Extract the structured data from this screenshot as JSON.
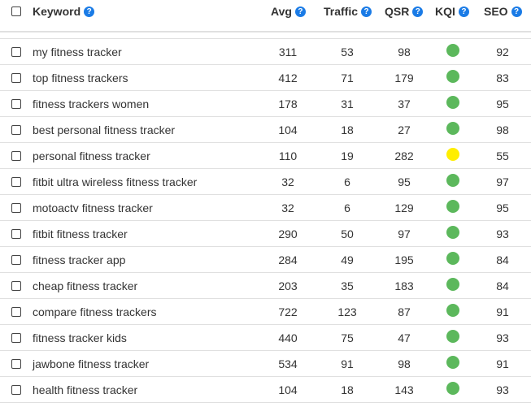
{
  "header": {
    "keyword": "Keyword",
    "avg": "Avg",
    "traffic": "Traffic",
    "qsr": "QSR",
    "kqi": "KQI",
    "seo": "SEO",
    "help_icon": "?"
  },
  "kqi_colors": {
    "green": "#5cb85c",
    "yellow": "#ffee00"
  },
  "rows": [
    {
      "keyword": "my fitness tracker",
      "avg": "311",
      "traffic": "53",
      "qsr": "98",
      "kqi": "green",
      "seo": "92"
    },
    {
      "keyword": "top fitness trackers",
      "avg": "412",
      "traffic": "71",
      "qsr": "179",
      "kqi": "green",
      "seo": "83"
    },
    {
      "keyword": "fitness trackers women",
      "avg": "178",
      "traffic": "31",
      "qsr": "37",
      "kqi": "green",
      "seo": "95"
    },
    {
      "keyword": "best personal fitness tracker",
      "avg": "104",
      "traffic": "18",
      "qsr": "27",
      "kqi": "green",
      "seo": "98"
    },
    {
      "keyword": "personal fitness tracker",
      "avg": "110",
      "traffic": "19",
      "qsr": "282",
      "kqi": "yellow",
      "seo": "55"
    },
    {
      "keyword": "fitbit ultra wireless fitness tracker",
      "avg": "32",
      "traffic": "6",
      "qsr": "95",
      "kqi": "green",
      "seo": "97"
    },
    {
      "keyword": "motoactv fitness tracker",
      "avg": "32",
      "traffic": "6",
      "qsr": "129",
      "kqi": "green",
      "seo": "95"
    },
    {
      "keyword": "fitbit fitness tracker",
      "avg": "290",
      "traffic": "50",
      "qsr": "97",
      "kqi": "green",
      "seo": "93"
    },
    {
      "keyword": "fitness tracker app",
      "avg": "284",
      "traffic": "49",
      "qsr": "195",
      "kqi": "green",
      "seo": "84"
    },
    {
      "keyword": "cheap fitness tracker",
      "avg": "203",
      "traffic": "35",
      "qsr": "183",
      "kqi": "green",
      "seo": "84"
    },
    {
      "keyword": "compare fitness trackers",
      "avg": "722",
      "traffic": "123",
      "qsr": "87",
      "kqi": "green",
      "seo": "91"
    },
    {
      "keyword": "fitness tracker kids",
      "avg": "440",
      "traffic": "75",
      "qsr": "47",
      "kqi": "green",
      "seo": "93"
    },
    {
      "keyword": "jawbone fitness tracker",
      "avg": "534",
      "traffic": "91",
      "qsr": "98",
      "kqi": "green",
      "seo": "91"
    },
    {
      "keyword": "health fitness tracker",
      "avg": "104",
      "traffic": "18",
      "qsr": "143",
      "kqi": "green",
      "seo": "93"
    }
  ]
}
